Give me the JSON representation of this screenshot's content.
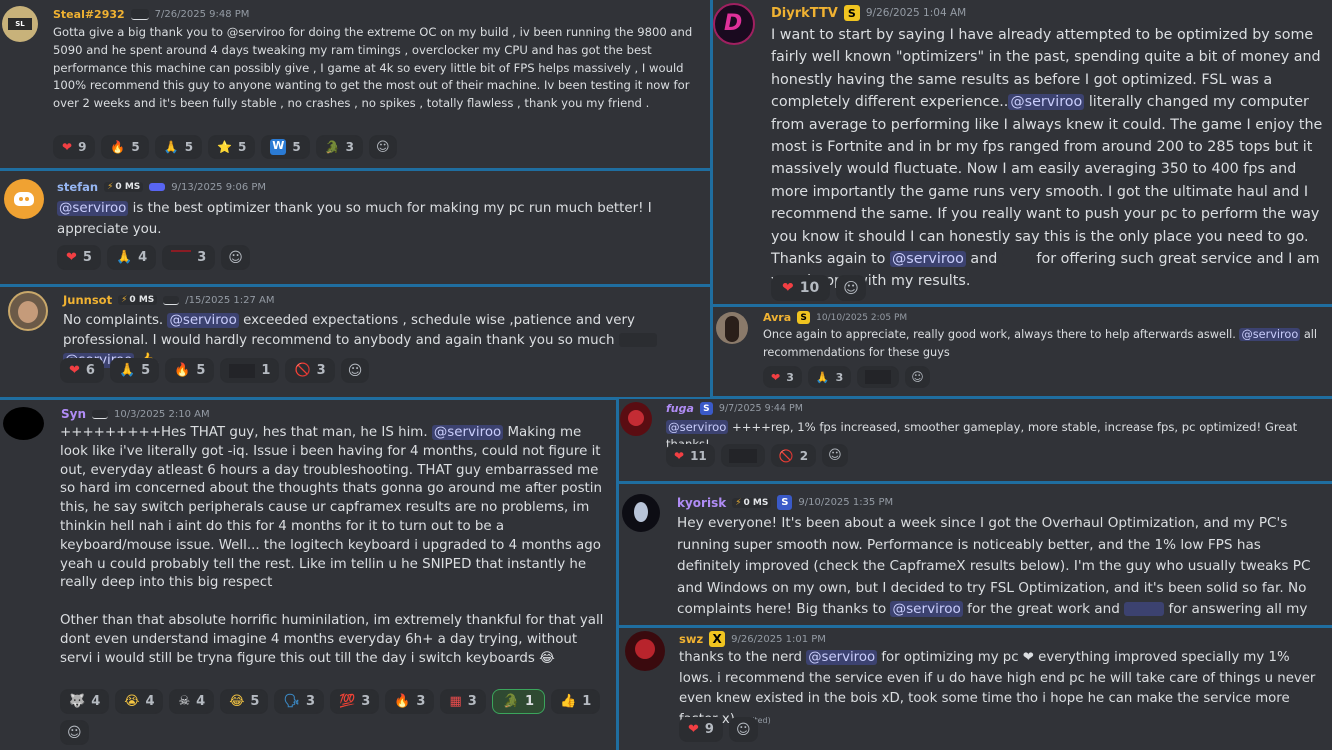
{
  "colors": {
    "background": "#1f6ea0",
    "card": "#313338",
    "mention_bg": "#3c4270"
  },
  "m1": {
    "user": "Steal#2932",
    "time": "7/26/2025 9:48 PM",
    "text": "Gotta give a big thank you to @serviroo for doing the extreme OC on my build , iv been running the 9800 and 5090 and he spent around 4 days tweaking my ram timings , overclocker my CPU and has got the best performance this machine can possibly give , I game at 4k so every little bit of FPS helps massively , I would 100% recommend this guy to anyone wanting to get the most out of their machine. Iv been testing it now for over 2 weeks and it's been fully stable , no crashes , no spikes , totally flawless , thank you my friend .",
    "reactions": [
      {
        "emoji": "❤",
        "count": "9"
      },
      {
        "emoji": "🔥",
        "count": "5"
      },
      {
        "emoji": "🙏",
        "count": "5"
      },
      {
        "emoji": "⭐",
        "count": "5"
      },
      {
        "emoji": "W",
        "count": "5"
      },
      {
        "emoji": "🐊",
        "count": "3"
      },
      {
        "emoji": "☺",
        "count": ""
      }
    ]
  },
  "m2": {
    "user": "stefan",
    "ping": "0 MS",
    "time": "9/13/2025 9:06 PM",
    "mention": "@serviroo",
    "text": " is the best optimizer thank you so much for making my pc run much better! I appreciate you.",
    "reactions": [
      {
        "emoji": "❤",
        "count": "5"
      },
      {
        "emoji": "🙏",
        "count": "4"
      },
      {
        "emoji": "",
        "count": "3"
      },
      {
        "emoji": "☺",
        "count": ""
      }
    ]
  },
  "m3": {
    "user": "Junnsot",
    "ping": "0 MS",
    "time": "/15/2025 1:27 AM",
    "t1": "No complaints. ",
    "mention": "@serviroo",
    "t2": " exceeded expectations , schedule wise ,patience and very professional. I would hardly recommend to anybody and again thank you so much ",
    "mention2": "@serviroo",
    "t3": "👍.",
    "reactions": [
      {
        "emoji": "❤",
        "count": "6"
      },
      {
        "emoji": "🙏",
        "count": "5"
      },
      {
        "emoji": "🔥",
        "count": "5"
      },
      {
        "emoji": "",
        "count": "1"
      },
      {
        "emoji": "🚫",
        "count": "3"
      },
      {
        "emoji": "☺",
        "count": ""
      }
    ]
  },
  "m4": {
    "user": "Syn",
    "time": "10/3/2025 2:10 AM",
    "t1": "+++++++++Hes THAT guy, hes that man, he IS him. ",
    "mention": "@serviroo",
    "t2": " Making me look like i've literally got -iq. Issue i been having for 4 months, could not figure it out, everyday atleast 6 hours a day troubleshooting. THAT guy embarrassed me so hard im concerned about the thoughts thats gonna go around me after postin this, he say switch peripherals cause ur capframex results are no problems, im thinkin hell nah i aint do this for 4 months for it to turn out to be a keyboard/mouse issue. Well... the logitech keyboard i upgraded to 4 months ago yeah u could probably tell the rest. Like im tellin u he SNIPED that instantly he really deep into this big respect",
    "t3": "Other than that absolute horrific huminilation, im extremely thankful for that yall dont even understand imagine 4 months everyday 6h+ a day trying, without servi i would still be tryna figure this out till the day i switch keyboards 😂",
    "reactions": [
      {
        "emoji": "🐺",
        "count": "4"
      },
      {
        "emoji": "😭",
        "count": "4"
      },
      {
        "emoji": "☠",
        "count": "4"
      },
      {
        "emoji": "😂",
        "count": "5"
      },
      {
        "emoji": "🗣",
        "count": "3"
      },
      {
        "emoji": "💯",
        "count": "3"
      },
      {
        "emoji": "🔥",
        "count": "3"
      },
      {
        "emoji": "▦",
        "count": "3"
      },
      {
        "emoji": "🐊",
        "count": "1",
        "on": true
      },
      {
        "emoji": "👍",
        "count": "1"
      },
      {
        "emoji": "☺",
        "count": ""
      }
    ]
  },
  "m5": {
    "user": "DiyrkTTV",
    "time": "9/26/2025 1:04 AM",
    "t1": "I want to start by saying I have already attempted to be optimized by some fairly well known \"optimizers\" in the past, spending quite a bit of money and honestly having the same results as before I got optimized. FSL was a completely different experience..",
    "mention": "@serviroo",
    "t2": " literally changed my computer from average to performing like I always knew it could. The game I enjoy the most is Fortnite and in br my fps ranged from around 200 to 285 tops but it massively would fluctuate. Now I am easily averaging 350 to 400 fps and more importantly the game runs very smooth. I got the ultimate haul and I recommend the same. If you really want to push your pc to perform the way you know it should I can honestly say this is the only place you need to go. Thanks again to ",
    "mention2": "@serviroo",
    "t3": " and ",
    "t4": " for offering such great service and I am very happy with my results.",
    "reactions": [
      {
        "emoji": "❤",
        "count": "10"
      },
      {
        "emoji": "☺",
        "count": ""
      }
    ]
  },
  "m6": {
    "user": "Avra",
    "time": "10/10/2025 2:05 PM",
    "t1": "Once again to appreciate, really good work, always there to help afterwards aswell. ",
    "mention": "@serviroo",
    "t2": " all recommendations for these guys",
    "reactions": [
      {
        "emoji": "❤",
        "count": "3"
      },
      {
        "emoji": "🙏",
        "count": "3"
      },
      {
        "emoji": "",
        "count": ""
      },
      {
        "emoji": "☺",
        "count": ""
      }
    ]
  },
  "m7": {
    "user": "fuga",
    "time": "9/7/2025 9:44 PM",
    "mention": "@serviroo",
    "text": " ++++rep, 1% fps increased, smoother gameplay, more stable, increase fps, pc optimized! Great thanks!",
    "reactions": [
      {
        "emoji": "❤",
        "count": "11"
      },
      {
        "emoji": "",
        "count": ""
      },
      {
        "emoji": "🚫",
        "count": "2"
      },
      {
        "emoji": "☺",
        "count": ""
      }
    ]
  },
  "m8": {
    "user": "kyorisk",
    "ping": "0 MS",
    "time": "9/10/2025 1:35 PM",
    "t1": "Hey everyone! It's been about a week since I got the Overhaul Optimization, and my PC's running super smooth now. Performance is noticeably better, and the 1% low FPS has definitely improved (check the CapframeX results below). I'm the guy who usually tweaks PC and Windows on my own, but I decided to try FSL Optimization, and it's been solid so far. No complaints here! Big thanks to ",
    "mention": "@serviroo",
    "t2": " for the great work and ",
    "t3": " for answering all my questions. You guys are awesome!"
  },
  "m9": {
    "user": "swz",
    "time": "9/26/2025 1:01 PM",
    "t1": "thanks to the nerd ",
    "mention": "@serviroo",
    "t2": " for optimizing my pc ❤ everything improved specially my 1% lows. i recommend the service even if u do have high end pc he will take care of things u never even knew existed in the bois xD, took some time tho i hope he can make the service more faster x) ",
    "edited": "(edited)",
    "reactions": [
      {
        "emoji": "❤",
        "count": "9"
      },
      {
        "emoji": "☺",
        "count": ""
      }
    ]
  }
}
